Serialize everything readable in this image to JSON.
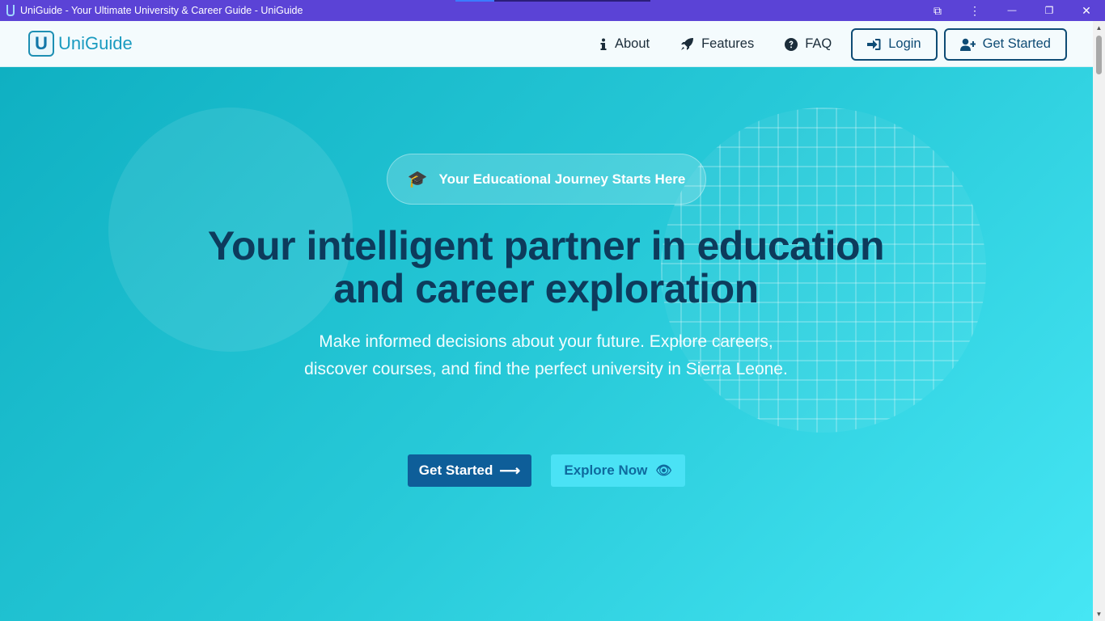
{
  "window": {
    "title": "UniGuide - Your Ultimate University & Career Guide - UniGuide",
    "controls": {
      "extensions": "⧉",
      "menu": "⋮",
      "minimize": "—",
      "restore": "❐",
      "close": "✕"
    }
  },
  "navbar": {
    "logo_mark": "U",
    "logo_text": "UniGuide",
    "links": [
      {
        "label": "About",
        "icon": "info-icon"
      },
      {
        "label": "Features",
        "icon": "rocket-icon"
      },
      {
        "label": "FAQ",
        "icon": "question-circle-icon"
      }
    ],
    "login_label": "Login",
    "get_started_label": "Get Started"
  },
  "hero": {
    "badge_icon": "🎓",
    "badge_text": "Your Educational Journey Starts Here",
    "headline_line1": "Your intelligent partner in education",
    "headline_line2": "and career exploration",
    "subtext": "Make informed decisions about your future. Explore careers, discover courses, and find the perfect university in Sierra Leone.",
    "primary_cta": "Get Started",
    "primary_cta_arrow": "⟶",
    "secondary_cta": "Explore Now",
    "secondary_cta_icon": "👁"
  },
  "colors": {
    "titlebar": "#5b43d6",
    "navbar_bg": "#f4fbfd",
    "brand_dark": "#0f4c75",
    "headline": "#0d3b5c",
    "hero_gradient_start": "#0fb0c2",
    "hero_gradient_end": "#46e6f4",
    "primary_cta_bg": "#0e5e99",
    "secondary_cta_bg": "#4ae2f5"
  }
}
